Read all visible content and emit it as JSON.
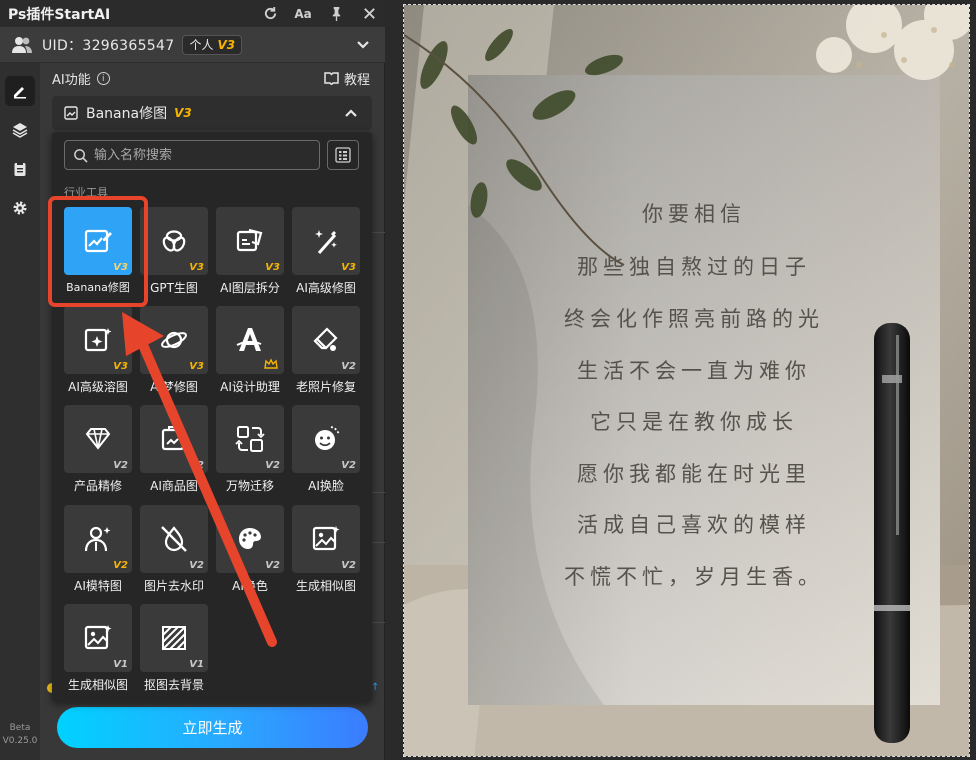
{
  "titlebar": {
    "title": "Ps插件StartAI",
    "font_icon_label": "Aa"
  },
  "user": {
    "uid": "UID：3296365547",
    "plan": "个人",
    "plan_version": "V3"
  },
  "ai": {
    "heading": "AI功能",
    "info_glyph": "i",
    "tutorial": "教程"
  },
  "section": {
    "title": "Banana修图",
    "version": "V3"
  },
  "search": {
    "placeholder": "输入名称搜索"
  },
  "category": "行业工具",
  "tools": [
    {
      "label": "Banana修图",
      "version": "V3",
      "icon": "image-edit-icon"
    },
    {
      "label": "GPT生图",
      "version": "V3",
      "icon": "gpt-knot-icon"
    },
    {
      "label": "AI图层拆分",
      "version": "V3",
      "icon": "layer-split-icon"
    },
    {
      "label": "AI高级修图",
      "version": "V3",
      "icon": "magic-wand-icon"
    },
    {
      "label": "AI高级溶图",
      "version": "V3",
      "icon": "sparkle-frame-icon"
    },
    {
      "label": "AI梦修图",
      "version": "V3",
      "icon": "planet-icon"
    },
    {
      "label": "AI设计助理",
      "version": "",
      "icon": "letter-a-icon"
    },
    {
      "label": "老照片修复",
      "version": "V2",
      "icon": "eraser-photo-icon"
    },
    {
      "label": "产品精修",
      "version": "V2",
      "icon": "diamond-icon"
    },
    {
      "label": "AI商品图",
      "version": "V2",
      "icon": "product-frame-icon"
    },
    {
      "label": "万物迁移",
      "version": "V2",
      "icon": "transfer-icon"
    },
    {
      "label": "AI换脸",
      "version": "V2",
      "icon": "face-swap-icon"
    },
    {
      "label": "AI模特图",
      "version": "V2",
      "icon": "model-person-icon"
    },
    {
      "label": "图片去水印",
      "version": "V2",
      "icon": "watermark-remove-icon"
    },
    {
      "label": "AI换色",
      "version": "V2",
      "icon": "palette-icon"
    },
    {
      "label": "生成相似图",
      "version": "V2",
      "icon": "similar-image-icon"
    },
    {
      "label": "生成相似图",
      "version": "V1",
      "icon": "similar-image-icon"
    },
    {
      "label": "抠图去背景",
      "version": "V1",
      "icon": "background-remove-icon"
    }
  ],
  "generate_label": "立即生成",
  "version": {
    "beta": "Beta",
    "number": "V0.25.0"
  },
  "poem": [
    "你要相信",
    "那些独自熬过的日子",
    "终会化作照亮前路的光",
    "生活不会一直为难你",
    "它只是在教你成长",
    "愿你我都能在时光里",
    "活成自己喜欢的模样",
    "不慌不忙，岁月生香。"
  ],
  "colors": {
    "accent": "#2fa3f5",
    "highlight": "#e6452c",
    "gold": "#f5b400"
  }
}
